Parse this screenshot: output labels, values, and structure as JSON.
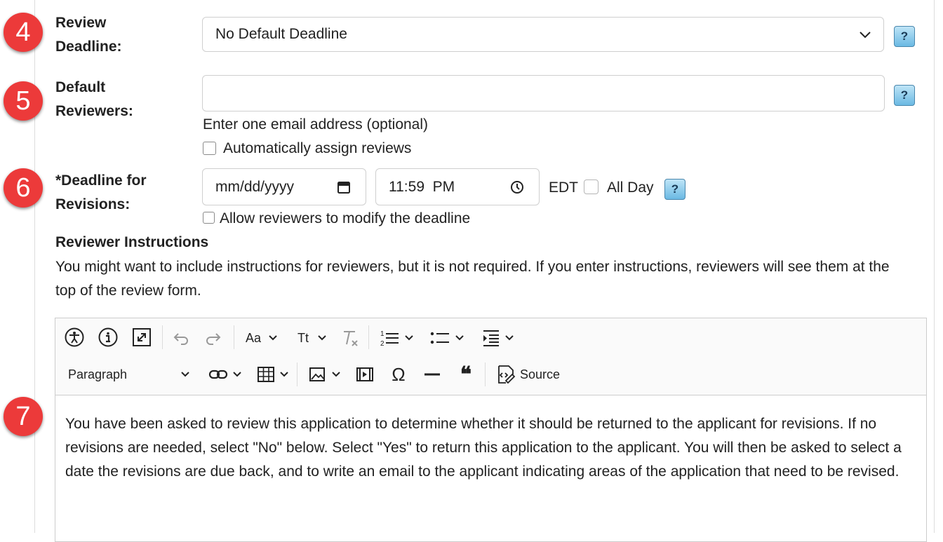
{
  "steps": {
    "review_deadline": {
      "badge": "4",
      "label_line1": "Review",
      "label_line2": "Deadline:",
      "select_value": "No Default Deadline"
    },
    "default_reviewers": {
      "badge": "5",
      "label_line1": "Default",
      "label_line2": "Reviewers:",
      "input_value": "",
      "helper": "Enter one email address (optional)",
      "auto_assign_label": "Automatically assign reviews"
    },
    "deadline_revisions": {
      "badge": "6",
      "label_line1": "*Deadline for",
      "label_line2": "Revisions:",
      "date_placeholder": "mm/dd/yyyy",
      "time_value": "11:59  PM",
      "timezone": "EDT",
      "all_day_label": "All Day",
      "allow_modify_label": "Allow reviewers to modify the deadline"
    },
    "editor_badge": "7"
  },
  "help_symbol": "?",
  "instructions": {
    "heading": "Reviewer Instructions",
    "description": "You might want to include instructions for reviewers, but it is not required. If you enter instructions, reviewers will see them at the top of the review form."
  },
  "editor": {
    "toolbar": {
      "row1": [
        "accessibility-icon",
        "info-icon",
        "fullscreen-icon",
        "undo-icon",
        "redo-icon",
        "font-size-icon",
        "text-transform-icon",
        "remove-format-icon",
        "numbered-list-icon",
        "bulleted-list-icon",
        "indent-icon"
      ],
      "font_size_label": "Aa",
      "text_transform_label": "Tt",
      "paragraph_label": "Paragraph",
      "source_label": "Source",
      "omega_symbol": "Ω",
      "quote_symbol": "❝"
    },
    "content": "You have been asked to review this application to determine whether it should be returned to the applicant for revisions. If no revisions are needed, select \"No\" below. Select \"Yes\" to return this application to the applicant. You will then be asked to select a date the revisions are due back, and to write an email to the applicant indicating areas of the application that need to be revised."
  },
  "colors": {
    "badge": "#ec3a3a",
    "help_button": "#6ab9e3",
    "border": "#cfcfcf"
  }
}
